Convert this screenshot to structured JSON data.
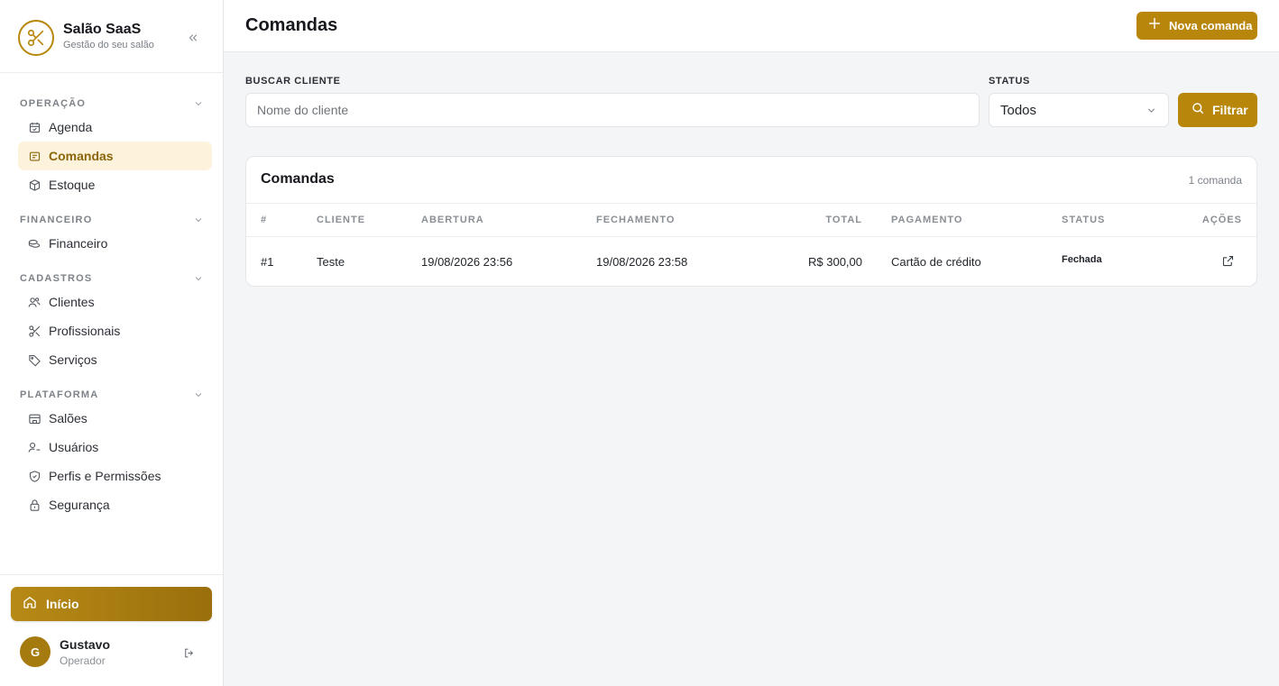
{
  "brand": {
    "name": "Salão SaaS",
    "tagline": "Gestão do seu salão",
    "icon": "scissors-icon",
    "accent": "#b8860b"
  },
  "sidebar": {
    "sections": [
      {
        "label": "OPERAÇÃO",
        "items": [
          {
            "label": "Agenda",
            "icon": "calendar-icon"
          },
          {
            "label": "Comandas",
            "icon": "receipt-icon",
            "active": true
          },
          {
            "label": "Estoque",
            "icon": "box-icon"
          }
        ]
      },
      {
        "label": "FINANCEIRO",
        "items": [
          {
            "label": "Financeiro",
            "icon": "coins-icon"
          }
        ]
      },
      {
        "label": "CADASTROS",
        "items": [
          {
            "label": "Clientes",
            "icon": "users-icon"
          },
          {
            "label": "Profissionais",
            "icon": "scissors-icon"
          },
          {
            "label": "Serviços",
            "icon": "tag-icon"
          }
        ]
      },
      {
        "label": "PLATAFORMA",
        "items": [
          {
            "label": "Salões",
            "icon": "store-icon"
          },
          {
            "label": "Usuários",
            "icon": "user-cog-icon"
          },
          {
            "label": "Perfis e Permissões",
            "icon": "shield-icon"
          },
          {
            "label": "Segurança",
            "icon": "lock-icon"
          }
        ]
      }
    ],
    "home_label": "Início",
    "user": {
      "initial": "G",
      "name": "Gustavo",
      "role": "Operador"
    }
  },
  "header": {
    "title": "Comandas",
    "new_button": "Nova comanda"
  },
  "filters": {
    "search_label": "BUSCAR CLIENTE",
    "search_placeholder": "Nome do cliente",
    "search_value": "",
    "status_label": "STATUS",
    "status_value": "Todos",
    "filter_button": "Filtrar"
  },
  "table": {
    "title": "Comandas",
    "count": "1 comanda",
    "columns": [
      "#",
      "CLIENTE",
      "ABERTURA",
      "FECHAMENTO",
      "TOTAL",
      "PAGAMENTO",
      "STATUS",
      "AÇÕES"
    ],
    "rows": [
      {
        "id": "#1",
        "cliente": "Teste",
        "abertura": "19/08/2026 23:56",
        "fechamento": "19/08/2026 23:58",
        "total": "R$ 300,00",
        "pagamento": "Cartão de crédito",
        "status": "Fechada",
        "action_icon": "external-link-icon"
      }
    ]
  }
}
